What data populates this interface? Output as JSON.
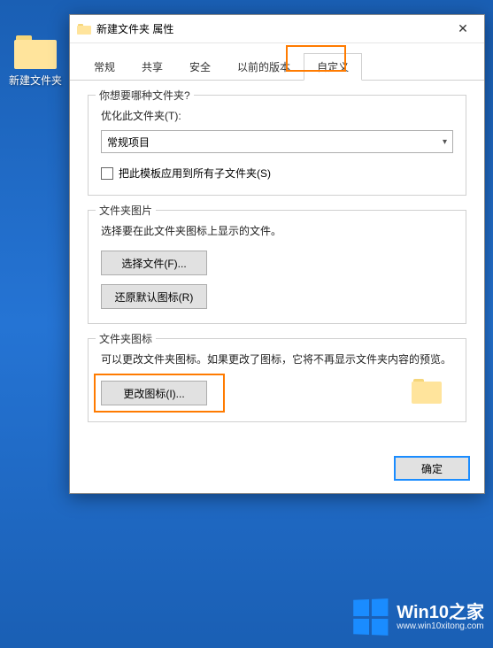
{
  "desktop": {
    "folder_label": "新建文件夹"
  },
  "dialog": {
    "title": "新建文件夹 属性",
    "close_label": "✕",
    "tabs": {
      "general": "常规",
      "sharing": "共享",
      "security": "安全",
      "previous": "以前的版本",
      "customize": "自定义"
    },
    "group1": {
      "title": "你想要哪种文件夹?",
      "optimize_label": "优化此文件夹(T):",
      "select_value": "常规项目",
      "apply_template_label": "把此模板应用到所有子文件夹(S)"
    },
    "group2": {
      "title": "文件夹图片",
      "desc": "选择要在此文件夹图标上显示的文件。",
      "choose_file_btn": "选择文件(F)...",
      "restore_default_btn": "还原默认图标(R)"
    },
    "group3": {
      "title": "文件夹图标",
      "desc": "可以更改文件夹图标。如果更改了图标，它将不再显示文件夹内容的预览。",
      "change_icon_btn": "更改图标(I)..."
    },
    "buttons": {
      "ok": "确定"
    }
  },
  "watermark": {
    "main": "Win10之家",
    "sub": "www.win10xitong.com"
  }
}
